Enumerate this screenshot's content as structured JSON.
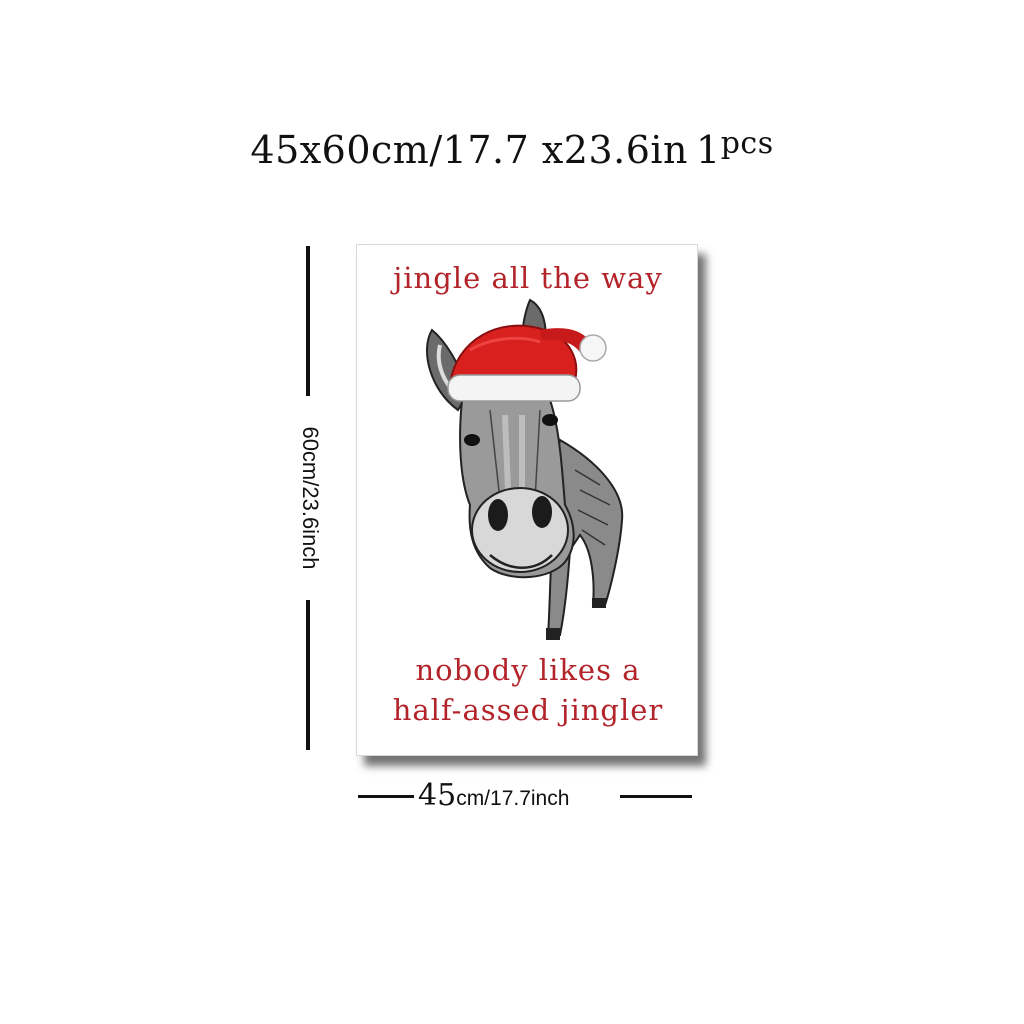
{
  "header": {
    "dims": "45x60cm/17.7 x23.6in",
    "qty_num": "1",
    "qty_unit": "pcs"
  },
  "height_label": "60cm/23.6inch",
  "width_label": {
    "big": "45",
    "small": "cm/17.7inch"
  },
  "poster": {
    "top_line": "jingle all the way",
    "bottom_line_1": "nobody likes a",
    "bottom_line_2": "half-assed jingler",
    "text_color": "#b3242a"
  },
  "illustration": {
    "subject": "donkey-icon",
    "hat": "santa-hat-icon"
  }
}
